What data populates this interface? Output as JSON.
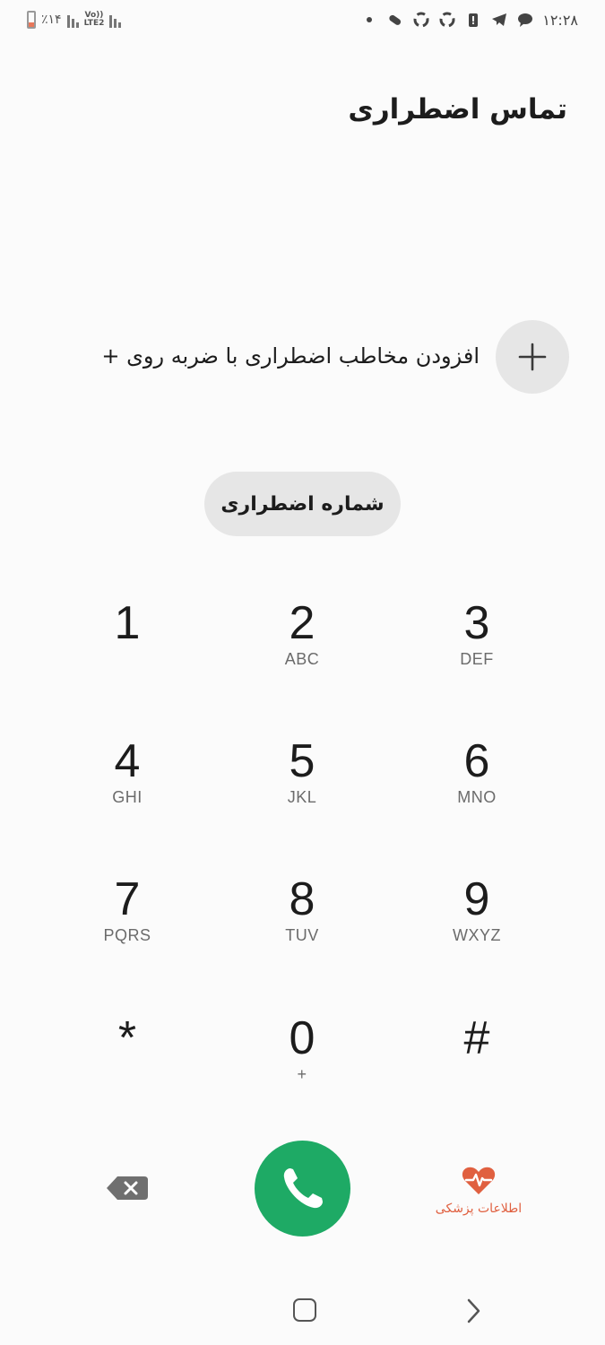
{
  "status_bar": {
    "battery_text": "٪۱۴",
    "network_label_top": "Vo))",
    "network_label_bottom": "LTE2",
    "time": "۱۲:۲۸",
    "icons": [
      "dot-icon",
      "pill-icon",
      "recycle-icon",
      "recycle-icon",
      "battery-alert-icon",
      "telegram-icon",
      "chat-icon"
    ]
  },
  "header": {
    "title": "تماس اضطراری"
  },
  "add_contact": {
    "label": "افزودن مخاطب اضطراری با ضربه روی +"
  },
  "emergency_number_button": {
    "label": "شماره اضطراری"
  },
  "keypad": [
    {
      "digit": "1",
      "letters": ""
    },
    {
      "digit": "2",
      "letters": "ABC"
    },
    {
      "digit": "3",
      "letters": "DEF"
    },
    {
      "digit": "4",
      "letters": "GHI"
    },
    {
      "digit": "5",
      "letters": "JKL"
    },
    {
      "digit": "6",
      "letters": "MNO"
    },
    {
      "digit": "7",
      "letters": "PQRS"
    },
    {
      "digit": "8",
      "letters": "TUV"
    },
    {
      "digit": "9",
      "letters": "WXYZ"
    },
    {
      "digit": "*",
      "letters": ""
    },
    {
      "digit": "0",
      "letters": "+"
    },
    {
      "digit": "#",
      "letters": ""
    }
  ],
  "actions": {
    "medical_info_label": "اطلاعات پزشکی"
  },
  "colors": {
    "call_green": "#1eaa65",
    "medical_red": "#e06040",
    "pill_bg": "#e6e6e6"
  }
}
